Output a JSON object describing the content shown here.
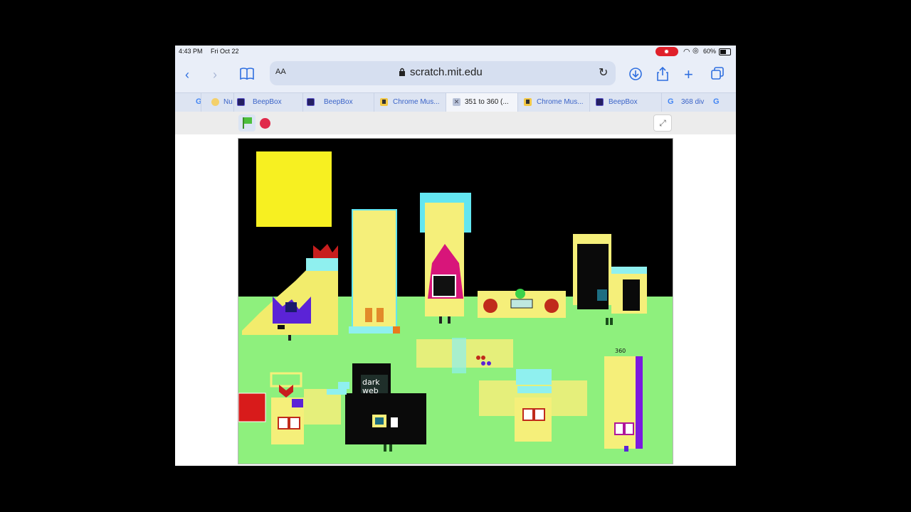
{
  "status_bar": {
    "time": "4:43 PM",
    "date": "Fri Oct 22",
    "battery": "60%"
  },
  "toolbar": {
    "text_size": "AA",
    "url": "scratch.mit.edu"
  },
  "tabs": [
    {
      "label": "Nu",
      "icon": "misc-icon"
    },
    {
      "label": "BeepBox",
      "icon": "beepbox-icon"
    },
    {
      "label": "BeepBox",
      "icon": "beepbox-icon"
    },
    {
      "label": "Chrome Mus...",
      "icon": "chrome-music-icon"
    },
    {
      "label": "351 to 360 (...",
      "icon": "close-icon",
      "active": true
    },
    {
      "label": "Chrome Mus...",
      "icon": "chrome-music-icon"
    },
    {
      "label": "BeepBox",
      "icon": "beepbox-icon"
    },
    {
      "label": "368 div",
      "icon": "google-icon"
    }
  ],
  "stage": {
    "sign_text_line1": "dark",
    "sign_text_line2": "web",
    "number_label": "360",
    "colors": {
      "sky": "#000000",
      "ground": "#8ef07d",
      "block": "#f7f59b",
      "accent": "#63e6f0"
    }
  }
}
